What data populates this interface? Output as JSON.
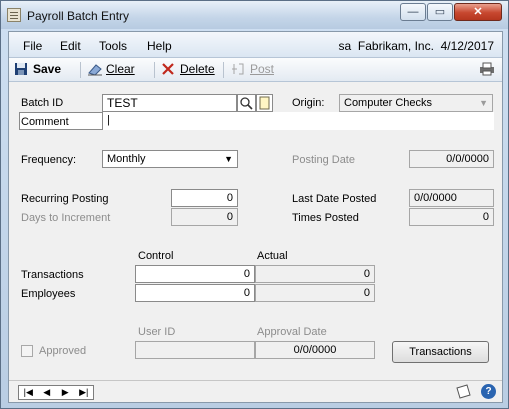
{
  "window": {
    "title": "Payroll Batch Entry",
    "min": "—",
    "restore": "▭",
    "close": "✕"
  },
  "menu": {
    "items": [
      "File",
      "Edit",
      "Tools",
      "Help"
    ],
    "user": "sa",
    "company": "Fabrikam, Inc.",
    "date": "4/12/2017"
  },
  "toolbar": {
    "save": "Save",
    "clear": "Clear",
    "delete": "Delete",
    "post": "Post"
  },
  "form": {
    "batch_id_label": "Batch ID",
    "batch_id": "TEST",
    "origin_label": "Origin:",
    "origin": "Computer Checks",
    "comment_label": "Comment",
    "comment": "|",
    "frequency_label": "Frequency:",
    "frequency": "Monthly",
    "posting_date_label": "Posting Date",
    "posting_date": "0/0/0000",
    "recurring_label": "Recurring Posting",
    "recurring": "0",
    "days_label": "Days to Increment",
    "days": "0",
    "last_posted_label": "Last Date Posted",
    "last_posted": "0/0/0000",
    "times_posted_label": "Times Posted",
    "times_posted": "0",
    "control_label": "Control",
    "actual_label": "Actual",
    "transactions_label": "Transactions",
    "transactions_control": "0",
    "transactions_actual": "0",
    "employees_label": "Employees",
    "employees_control": "0",
    "employees_actual": "0",
    "approved_label": "Approved",
    "user_id_label": "User ID",
    "user_id": "",
    "approval_date_label": "Approval Date",
    "approval_date": "0/0/0000",
    "transactions_button": "Transactions"
  },
  "colors": {
    "accent": "#2a64b0",
    "delete_red": "#c0281c"
  }
}
